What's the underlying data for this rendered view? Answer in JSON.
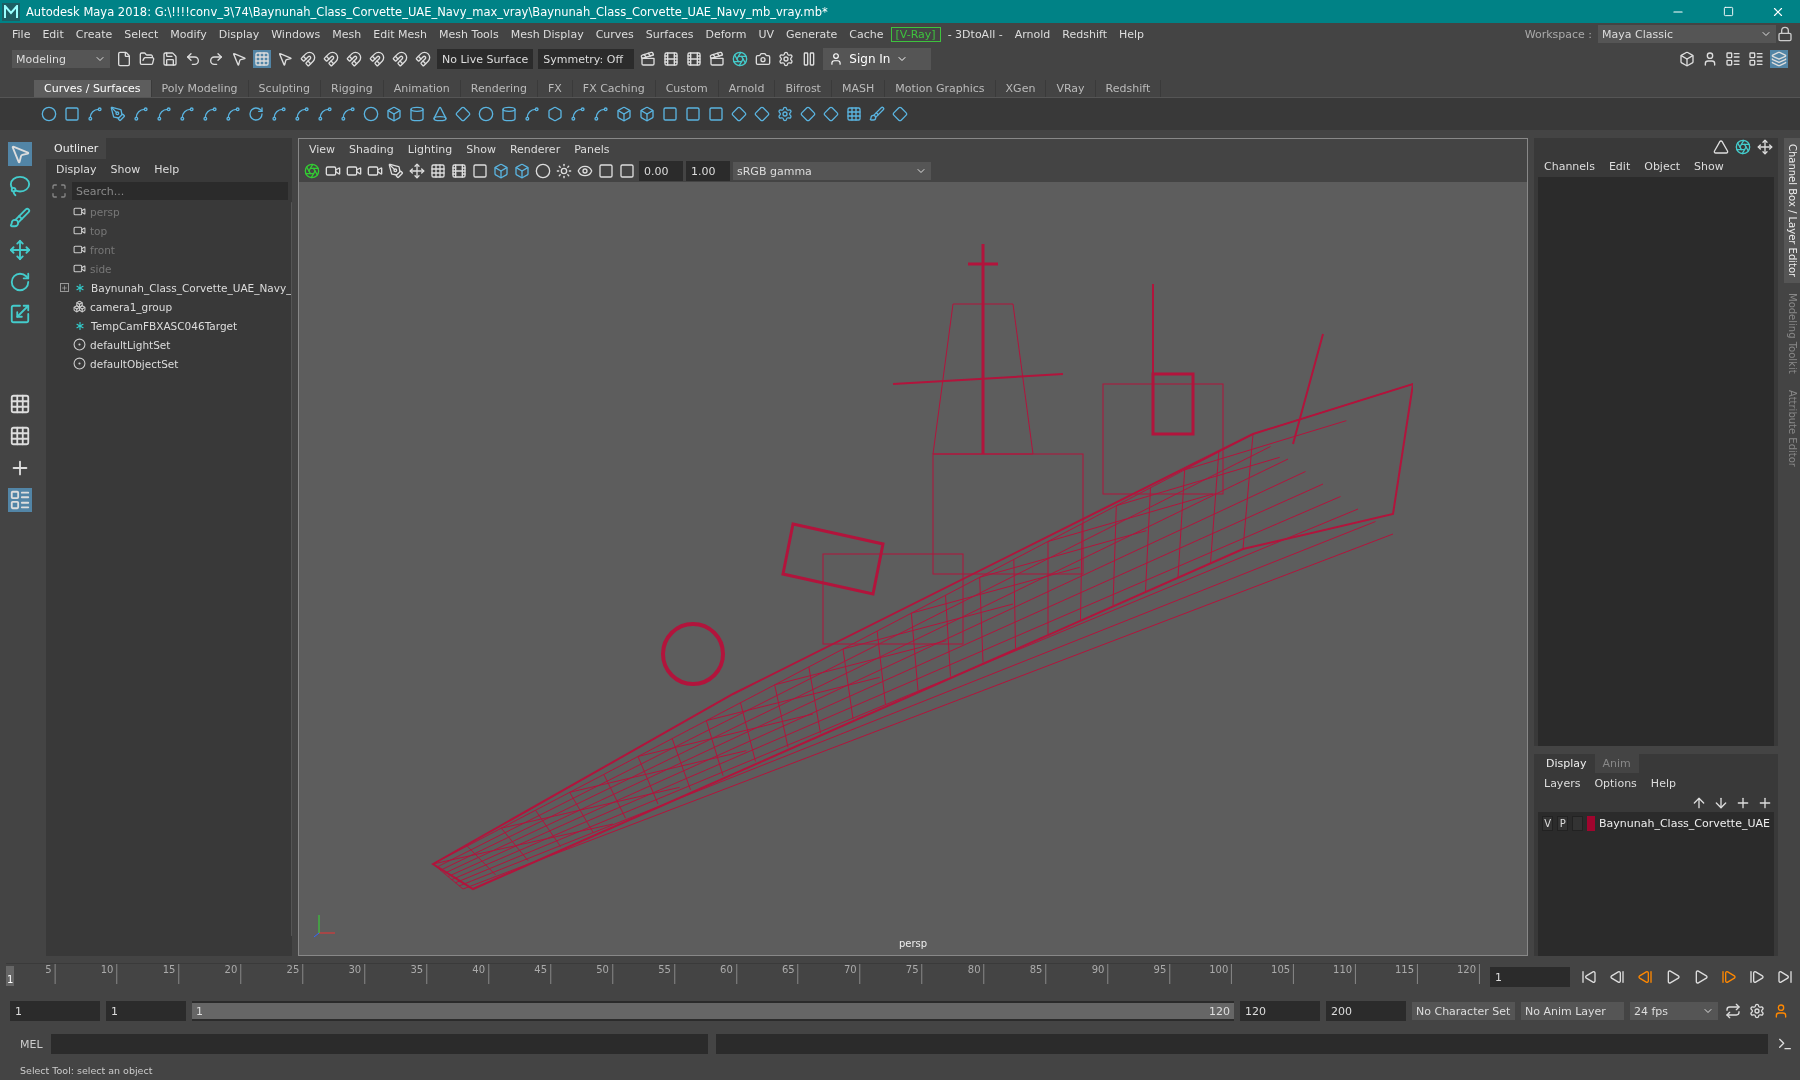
{
  "window": {
    "title": "Autodesk Maya 2018: G:\\!!!!conv_3\\74\\Baynunah_Class_Corvette_UAE_Navy_max_vray\\Baynunah_Class_Corvette_UAE_Navy_mb_vray.mb*"
  },
  "menu_bar": [
    {
      "label": "File",
      "kind": "plain"
    },
    {
      "label": "Edit",
      "kind": "plain"
    },
    {
      "label": "Create",
      "kind": "plain"
    },
    {
      "label": "Select",
      "kind": "plain"
    },
    {
      "label": "Modify",
      "kind": "plain"
    },
    {
      "label": "Display",
      "kind": "plain"
    },
    {
      "label": "Windows",
      "kind": "plain"
    },
    {
      "label": "Mesh",
      "kind": "plain"
    },
    {
      "label": "Edit Mesh",
      "kind": "plain"
    },
    {
      "label": "Mesh Tools",
      "kind": "plain"
    },
    {
      "label": "Mesh Display",
      "kind": "plain"
    },
    {
      "label": "Curves",
      "kind": "plain"
    },
    {
      "label": "Surfaces",
      "kind": "plain"
    },
    {
      "label": "Deform",
      "kind": "plain"
    },
    {
      "label": "UV",
      "kind": "plain"
    },
    {
      "label": "Generate",
      "kind": "plain"
    },
    {
      "label": "Cache",
      "kind": "plain"
    },
    {
      "label": "[V-Ray]",
      "kind": "highlight"
    },
    {
      "label": "- 3DtoAll -",
      "kind": "plain"
    },
    {
      "label": "Arnold",
      "kind": "plain"
    },
    {
      "label": "Redshift",
      "kind": "plain"
    },
    {
      "label": "Help",
      "kind": "plain"
    }
  ],
  "workspace": {
    "label": "Workspace :",
    "value": "Maya Classic"
  },
  "status_line": {
    "mode": "Modeling",
    "live_surface": "No Live Surface",
    "symmetry": "Symmetry: Off",
    "sign_in": "Sign In"
  },
  "shelf_tabs": [
    {
      "label": "Curves / Surfaces",
      "selected": true
    },
    {
      "label": "Poly Modeling",
      "selected": false
    },
    {
      "label": "Sculpting",
      "selected": false
    },
    {
      "label": "Rigging",
      "selected": false
    },
    {
      "label": "Animation",
      "selected": false
    },
    {
      "label": "Rendering",
      "selected": false
    },
    {
      "label": "FX",
      "selected": false
    },
    {
      "label": "FX Caching",
      "selected": false
    },
    {
      "label": "Custom",
      "selected": false
    },
    {
      "label": "Arnold",
      "selected": false
    },
    {
      "label": "Bifrost",
      "selected": false
    },
    {
      "label": "MASH",
      "selected": false
    },
    {
      "label": "Motion Graphics",
      "selected": false
    },
    {
      "label": "XGen",
      "selected": false
    },
    {
      "label": "VRay",
      "selected": false
    },
    {
      "label": "Redshift",
      "selected": false
    }
  ],
  "outliner": {
    "title": "Outliner",
    "menu": [
      "Display",
      "Show",
      "Help"
    ],
    "search": {
      "placeholder": "Search..."
    },
    "items": [
      {
        "label": "persp",
        "kind": "camera",
        "dimmed": true,
        "expander": false
      },
      {
        "label": "top",
        "kind": "camera",
        "dimmed": true,
        "expander": false
      },
      {
        "label": "front",
        "kind": "camera",
        "dimmed": true,
        "expander": false
      },
      {
        "label": "side",
        "kind": "camera",
        "dimmed": true,
        "expander": false
      },
      {
        "label": "Baynunah_Class_Corvette_UAE_Navy_",
        "kind": "transform",
        "dimmed": false,
        "expander": true
      },
      {
        "label": "camera1_group",
        "kind": "group",
        "dimmed": false,
        "expander": false
      },
      {
        "label": "TempCamFBXASC046Target",
        "kind": "transform",
        "dimmed": false,
        "expander": false
      },
      {
        "label": "defaultLightSet",
        "kind": "set",
        "dimmed": false,
        "expander": false
      },
      {
        "label": "defaultObjectSet",
        "kind": "set",
        "dimmed": false,
        "expander": false
      }
    ]
  },
  "viewport": {
    "menu": [
      "View",
      "Shading",
      "Lighting",
      "Show",
      "Renderer",
      "Panels"
    ],
    "exposure": "0.00",
    "gamma": "1.00",
    "color_space": "sRGB gamma",
    "camera_label": "persp"
  },
  "channel_box": {
    "menu": [
      "Channels",
      "Edit",
      "Object",
      "Show"
    ]
  },
  "side_tabs": [
    {
      "label": "Channel Box / Layer Editor",
      "selected": true
    },
    {
      "label": "Modeling Toolkit",
      "selected": false
    },
    {
      "label": "Attribute Editor",
      "selected": false
    }
  ],
  "layer_editor": {
    "tabs": [
      {
        "label": "Display",
        "selected": true
      },
      {
        "label": "Anim",
        "selected": false
      }
    ],
    "menu": [
      "Layers",
      "Options",
      "Help"
    ],
    "layers": [
      {
        "visible": "V",
        "playback": "P",
        "color": "#a0052e",
        "name": "Baynunah_Class_Corvette_UAE"
      }
    ]
  },
  "timeline": {
    "current": "1",
    "level": 0,
    "ticks": [
      "5",
      "10",
      "15",
      "20",
      "25",
      "30",
      "35",
      "40",
      "45",
      "50",
      "55",
      "60",
      "65",
      "70",
      "75",
      "80",
      "85",
      "90",
      "95",
      "100",
      "105",
      "110",
      "115",
      "120"
    ],
    "frame_field": "1"
  },
  "range": {
    "start": "1",
    "playback_start": "1",
    "slider_start": "1",
    "slider_end": "120",
    "playback_end": "120",
    "end": "200",
    "character_set": "No Character Set",
    "anim_layer": "No Anim Layer",
    "fps": "24 fps",
    "level": 1
  },
  "command_line": {
    "label": "MEL"
  },
  "help_line": "Select Tool: select an object"
}
